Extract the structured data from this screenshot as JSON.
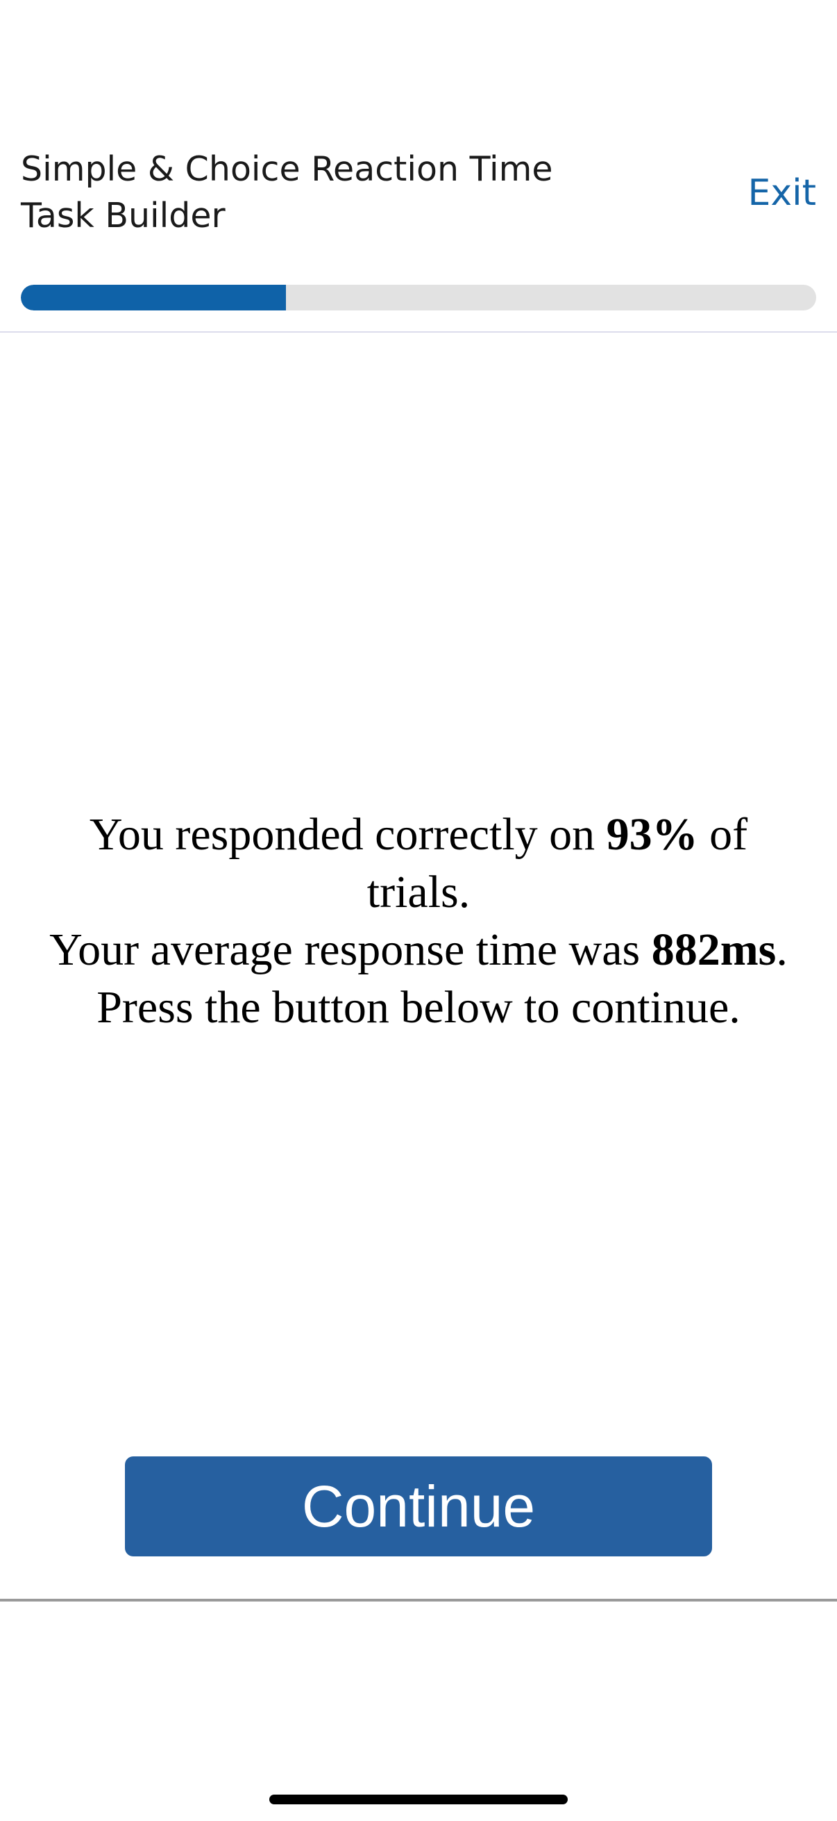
{
  "header": {
    "title_line1": "Simple & Choice Reaction Time",
    "title_line2": "Task Builder",
    "exit_label": "Exit",
    "progress_fraction": 0.333,
    "accent_color": "#0f62a8"
  },
  "message": {
    "line1_prefix": "You responded correctly on ",
    "line1_value": "93%",
    "line1_suffix": " of",
    "line2": "trials.",
    "line3_prefix": "Your average response time was ",
    "line3_value": "882ms",
    "line3_suffix": ".",
    "line4": "Press the button below to continue."
  },
  "actions": {
    "continue_label": "Continue",
    "continue_color": "#2660a0"
  }
}
